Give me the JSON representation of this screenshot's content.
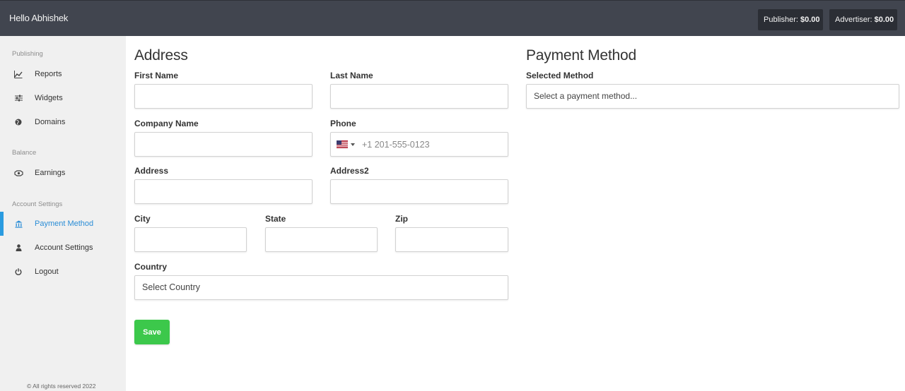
{
  "header": {
    "greeting": "Hello Abhishek",
    "publisher_label": "Publisher: ",
    "publisher_value": "$0.00",
    "advertiser_label": "Advertiser: ",
    "advertiser_value": "$0.00"
  },
  "sidebar": {
    "sections": [
      {
        "title": "Publishing"
      },
      {
        "title": "Balance"
      },
      {
        "title": "Account Settings"
      }
    ],
    "items": [
      {
        "label": "Reports",
        "icon": "chart-line-icon"
      },
      {
        "label": "Widgets",
        "icon": "sliders-icon"
      },
      {
        "label": "Domains",
        "icon": "globe-icon"
      },
      {
        "label": "Earnings",
        "icon": "money-icon"
      },
      {
        "label": "Payment Method",
        "icon": "bank-icon",
        "active": true
      },
      {
        "label": "Account Settings",
        "icon": "user-icon"
      },
      {
        "label": "Logout",
        "icon": "power-icon"
      }
    ],
    "footer": "© All rights reserved 2022"
  },
  "address": {
    "heading": "Address",
    "first_name": {
      "label": "First Name",
      "value": ""
    },
    "last_name": {
      "label": "Last Name",
      "value": ""
    },
    "company_name": {
      "label": "Company Name",
      "value": ""
    },
    "phone": {
      "label": "Phone",
      "placeholder": "+1 201-555-0123",
      "value": "",
      "country_flag": "us-flag-icon"
    },
    "address1": {
      "label": "Address",
      "value": ""
    },
    "address2": {
      "label": "Address2",
      "value": ""
    },
    "city": {
      "label": "City",
      "value": ""
    },
    "state": {
      "label": "State",
      "value": ""
    },
    "zip": {
      "label": "Zip",
      "value": ""
    },
    "country": {
      "label": "Country",
      "selected": "Select Country"
    },
    "save_label": "Save"
  },
  "payment": {
    "heading": "Payment Method",
    "selected_method": {
      "label": "Selected Method",
      "selected": "Select a payment method..."
    }
  },
  "colors": {
    "topbar": "#41454f",
    "accent": "#2a8dd6",
    "save": "#3cc84b",
    "sidebar_bg": "#f0f0f0"
  }
}
